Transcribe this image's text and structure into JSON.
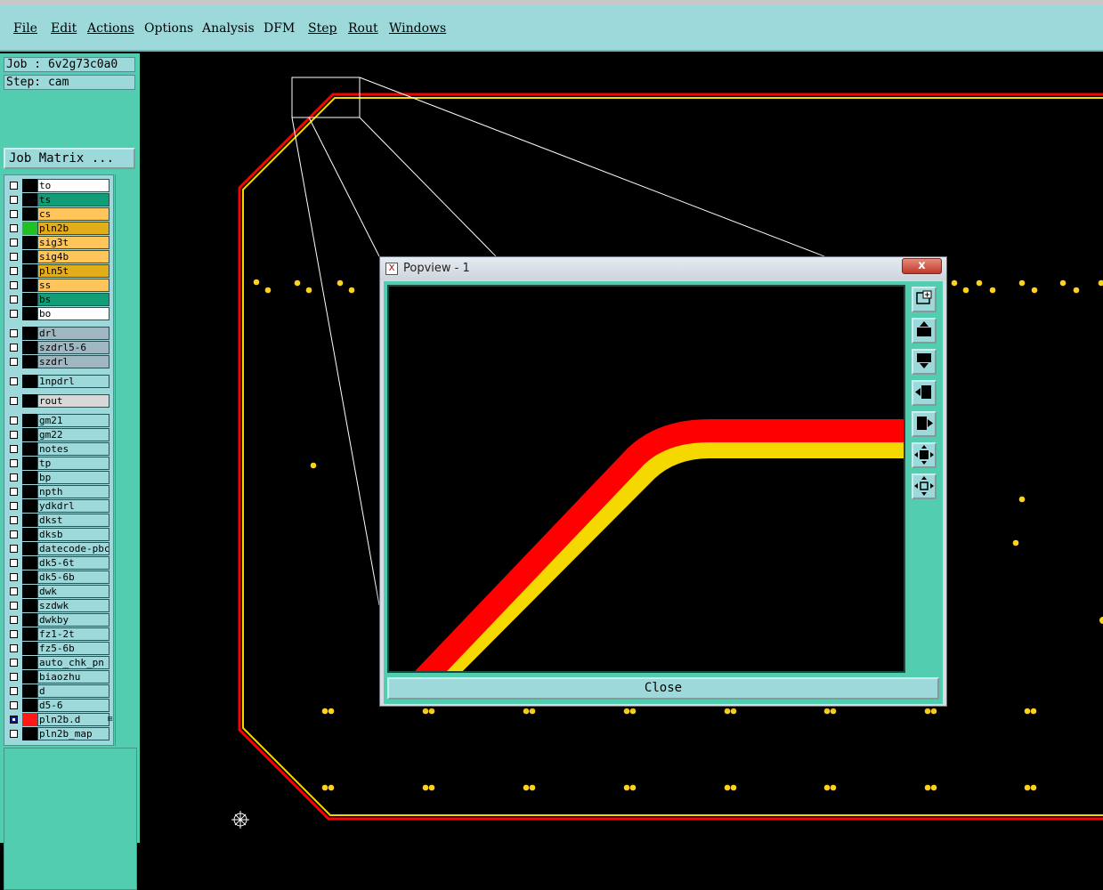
{
  "menu": {
    "items": [
      {
        "label": "File",
        "underline": true
      },
      {
        "label": "Edit",
        "underline": true
      },
      {
        "label": "Actions",
        "underline": true
      },
      {
        "label": "Options",
        "underline": false
      },
      {
        "label": "Analysis",
        "underline": false
      },
      {
        "label": "DFM",
        "underline": false
      },
      {
        "label": "Step",
        "underline": true
      },
      {
        "label": "Rout",
        "underline": true
      },
      {
        "label": "Windows",
        "underline": true
      }
    ]
  },
  "left_panel": {
    "job_label": "Job : 6v2g73c0a0",
    "step_label": "Step: cam",
    "job_matrix_button": "Job Matrix ..."
  },
  "layers": [
    {
      "name": "to",
      "color": "#ffffff",
      "checked": false,
      "active": false
    },
    {
      "name": "ts",
      "color": "#119e77",
      "checked": false,
      "active": false
    },
    {
      "name": "cs",
      "color": "#ffc55a",
      "checked": false,
      "active": false
    },
    {
      "name": "pln2b",
      "color": "#e2ac1a",
      "checked": false,
      "active": "#21c024"
    },
    {
      "name": "sig3t",
      "color": "#ffc55a",
      "checked": false,
      "active": false
    },
    {
      "name": "sig4b",
      "color": "#ffc55a",
      "checked": false,
      "active": false
    },
    {
      "name": "pln5t",
      "color": "#e2ac1a",
      "checked": false,
      "active": false
    },
    {
      "name": "ss",
      "color": "#ffc55a",
      "checked": false,
      "active": false
    },
    {
      "name": "bs",
      "color": "#119e77",
      "checked": false,
      "active": false
    },
    {
      "name": "bo",
      "color": "#ffffff",
      "checked": false,
      "active": false
    },
    {
      "name": "drl",
      "color": "#9fb7c0",
      "checked": false,
      "active": false,
      "gap": 6
    },
    {
      "name": "szdrl5-6",
      "color": "#9fb7c0",
      "checked": false,
      "active": false
    },
    {
      "name": "szdrl",
      "color": "#9fb7c0",
      "checked": false,
      "active": false
    },
    {
      "name": "1npdrl",
      "color": "#9dd9da",
      "checked": false,
      "active": false,
      "gap": 6
    },
    {
      "name": "rout",
      "color": "#d8d8d8",
      "checked": false,
      "active": false,
      "gap": 6
    },
    {
      "name": "gm21",
      "color": "#9dd9da",
      "checked": false,
      "active": false,
      "gap": 6
    },
    {
      "name": "gm22",
      "color": "#9dd9da",
      "checked": false,
      "active": false
    },
    {
      "name": "notes",
      "color": "#9dd9da",
      "checked": false,
      "active": false
    },
    {
      "name": "tp",
      "color": "#9dd9da",
      "checked": false,
      "active": false
    },
    {
      "name": "bp",
      "color": "#9dd9da",
      "checked": false,
      "active": false
    },
    {
      "name": "npth",
      "color": "#9dd9da",
      "checked": false,
      "active": false
    },
    {
      "name": "ydkdrl",
      "color": "#9dd9da",
      "checked": false,
      "active": false
    },
    {
      "name": "dkst",
      "color": "#9dd9da",
      "checked": false,
      "active": false
    },
    {
      "name": "dksb",
      "color": "#9dd9da",
      "checked": false,
      "active": false
    },
    {
      "name": "datecode-pbc",
      "color": "#9dd9da",
      "checked": false,
      "active": false
    },
    {
      "name": "dk5-6t",
      "color": "#9dd9da",
      "checked": false,
      "active": false
    },
    {
      "name": "dk5-6b",
      "color": "#9dd9da",
      "checked": false,
      "active": false
    },
    {
      "name": "dwk",
      "color": "#9dd9da",
      "checked": false,
      "active": false
    },
    {
      "name": "szdwk",
      "color": "#9dd9da",
      "checked": false,
      "active": false
    },
    {
      "name": "dwkby",
      "color": "#9dd9da",
      "checked": false,
      "active": false
    },
    {
      "name": "fz1-2t",
      "color": "#9dd9da",
      "checked": false,
      "active": false
    },
    {
      "name": "fz5-6b",
      "color": "#9dd9da",
      "checked": false,
      "active": false
    },
    {
      "name": "auto_chk_pn",
      "color": "#9dd9da",
      "checked": false,
      "active": false
    },
    {
      "name": "biaozhu",
      "color": "#9dd9da",
      "checked": false,
      "active": false
    },
    {
      "name": "d",
      "color": "#9dd9da",
      "checked": false,
      "active": false
    },
    {
      "name": "d5-6",
      "color": "#9dd9da",
      "checked": false,
      "active": false
    },
    {
      "name": "pln2b.d",
      "color": "#9dd9da",
      "checked": true,
      "active": "#ff1a1a",
      "marker": "⊞"
    },
    {
      "name": "pln2b_map",
      "color": "#9dd9da",
      "checked": false,
      "active": false
    }
  ],
  "popview": {
    "title": "Popview - 1",
    "icon_glyph": "X",
    "close_x": "x",
    "close_button": "Close",
    "tools": [
      "zoom-in-icon",
      "pan-up-icon",
      "pan-down-icon",
      "pan-left-icon",
      "pan-right-icon",
      "zoom-fit-icon",
      "zoom-home-icon"
    ]
  },
  "colors": {
    "panel_teal": "#53cdb0",
    "menu_bg": "#9dd9da",
    "trace_red": "#ff0000",
    "trace_yellow": "#f5d800",
    "pad_yellow": "#ffd21a"
  }
}
